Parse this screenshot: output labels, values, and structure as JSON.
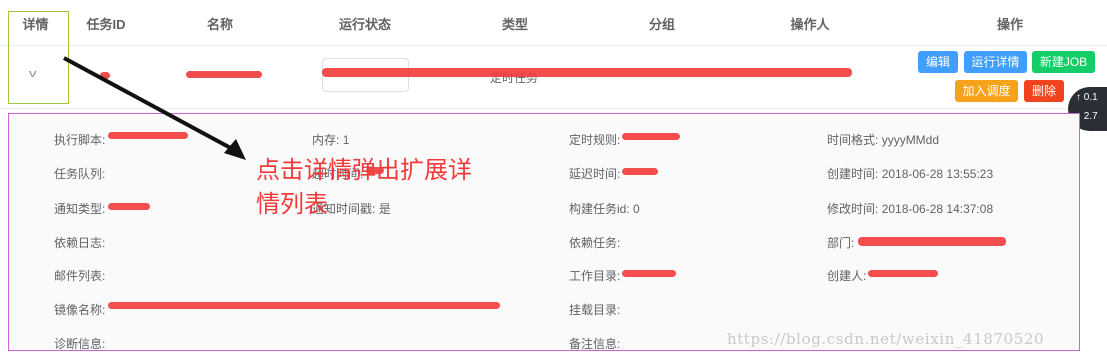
{
  "header": {
    "columns": [
      "详情",
      "任务ID",
      "名称",
      "运行状态",
      "类型",
      "分组",
      "操作人",
      "操作"
    ]
  },
  "row": {
    "expand_symbol": "v",
    "type_text": "定时任务",
    "buttons": {
      "edit": "编辑",
      "run_detail": "运行详情",
      "new_job": "新建JOB",
      "add_schedule": "加入调度",
      "delete": "删除"
    }
  },
  "detail": {
    "script": {
      "label": "执行脚本:",
      "value": ""
    },
    "memory": {
      "label": "内存:",
      "value": "1"
    },
    "cron": {
      "label": "定时规则:",
      "value": ""
    },
    "time_format": {
      "label": "时间格式:",
      "value": "yyyyMMdd"
    },
    "queue": {
      "label": "任务队列:",
      "value": ""
    },
    "timeout": {
      "label": "超时时间:",
      "value": ""
    },
    "delay": {
      "label": "延迟时间:",
      "value": ""
    },
    "created_time": {
      "label": "创建时间:",
      "value": "2018-06-28 13:55:23"
    },
    "notify_type": {
      "label": "通知类型:",
      "value": ""
    },
    "timestamp": {
      "label": "通知时间戳:",
      "value": "是"
    },
    "build_task_id": {
      "label": "构建任务id:",
      "value": "0"
    },
    "modified_time": {
      "label": "修改时间:",
      "value": "2018-06-28 14:37:08"
    },
    "dep_log": {
      "label": "依赖日志:",
      "value": ""
    },
    "dep_task": {
      "label": "依赖任务:",
      "value": ""
    },
    "dept": {
      "label": "部门:",
      "value": ""
    },
    "mail_list": {
      "label": "邮件列表:",
      "value": ""
    },
    "work_dir": {
      "label": "工作目录:",
      "value": ""
    },
    "creator": {
      "label": "创建人:",
      "value": ""
    },
    "image_name": {
      "label": "镜像名称:",
      "value": ""
    },
    "mount_dir": {
      "label": "挂载目录:",
      "value": ""
    },
    "diagnosis": {
      "label": "诊断信息:",
      "value": ""
    },
    "remark": {
      "label": "备注信息:",
      "value": ""
    }
  },
  "annotation": {
    "line1": "点击详情弹出扩展详",
    "line2": "情列表"
  },
  "watermark": "https://blog.csdn.net/weixin_41870520",
  "floater": {
    "up": "0.1",
    "down": "2.7"
  },
  "colors": {
    "primary": "#409eff",
    "success": "#13ce66",
    "warning": "#f7a21b",
    "danger": "#f0431e",
    "annotation_red": "#f23a3a"
  }
}
